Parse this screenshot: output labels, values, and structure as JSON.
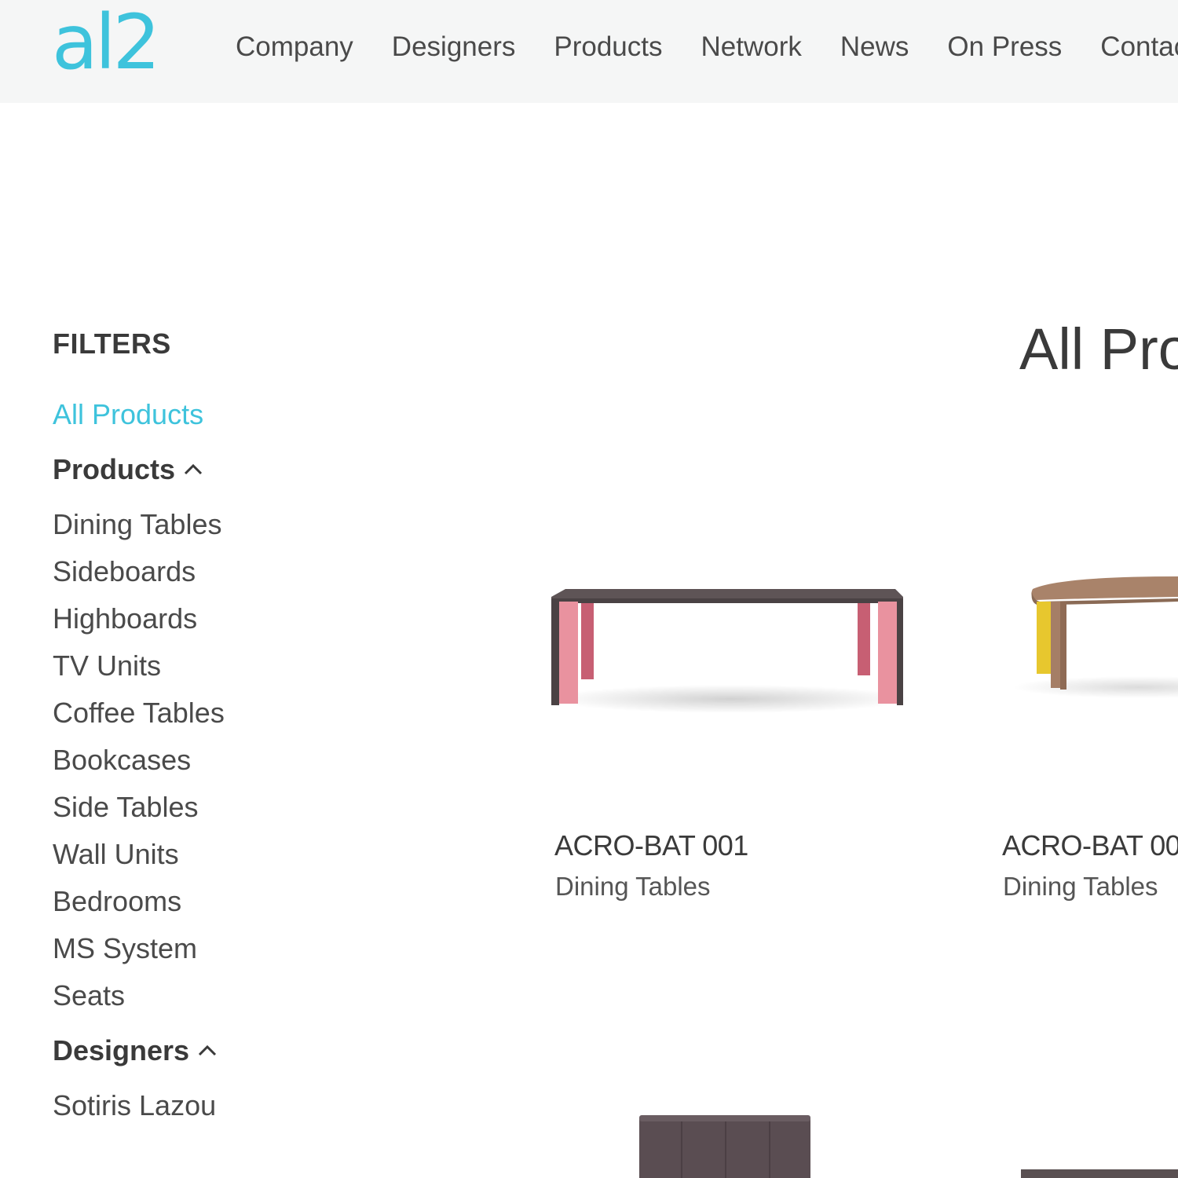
{
  "brand": {
    "logo_text": "al2",
    "accent_color": "#3ec3dc"
  },
  "nav": {
    "items": [
      "Company",
      "Designers",
      "Products",
      "Network",
      "News",
      "On Press",
      "Contac"
    ]
  },
  "filters": {
    "title": "FILTERS",
    "all_label": "All Products",
    "products_group": {
      "label": "Products",
      "icon": "chevron-up-icon",
      "items": [
        "Dining Tables",
        "Sideboards",
        "Highboards",
        "TV Units",
        "Coffee Tables",
        "Bookcases",
        "Side Tables",
        "Wall Units",
        "Bedrooms",
        "MS System",
        "Seats"
      ]
    },
    "designers_group": {
      "label": "Designers",
      "icon": "chevron-up-icon",
      "items": [
        "Sotiris Lazou"
      ]
    }
  },
  "main": {
    "heading": "All Pro",
    "products": [
      {
        "name": "ACRO-BAT 001",
        "category": "Dining Tables"
      },
      {
        "name": "ACRO-BAT 00",
        "category": "Dining Tables"
      }
    ]
  }
}
